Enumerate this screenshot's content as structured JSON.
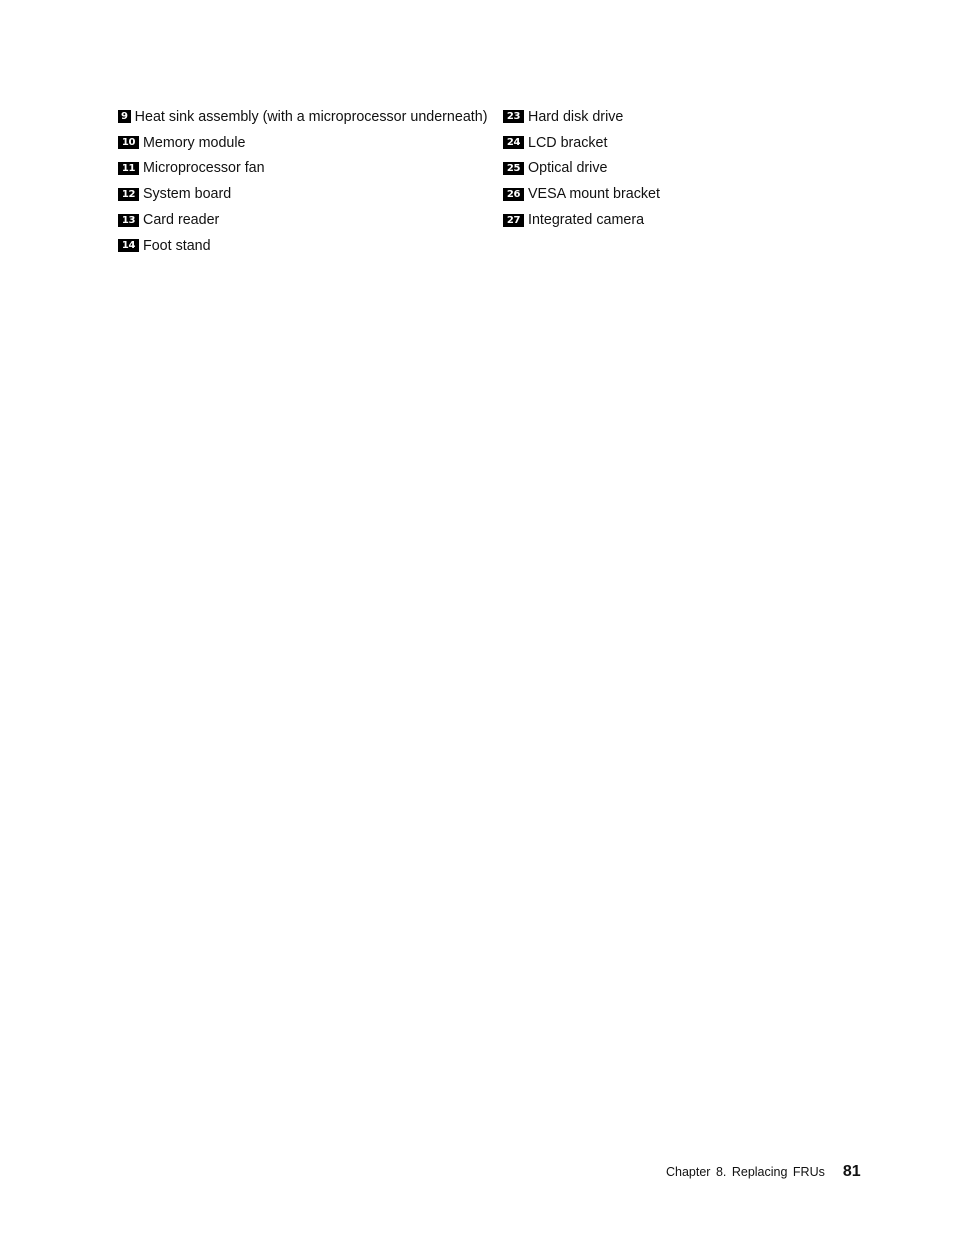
{
  "legend": {
    "left": [
      {
        "number": "9",
        "label": "Heat sink assembly (with a microprocessor underneath)"
      },
      {
        "number": "10",
        "label": "Memory module"
      },
      {
        "number": "11",
        "label": "Microprocessor fan"
      },
      {
        "number": "12",
        "label": "System board"
      },
      {
        "number": "13",
        "label": "Card reader"
      },
      {
        "number": "14",
        "label": "Foot stand"
      }
    ],
    "right": [
      {
        "number": "23",
        "label": "Hard disk drive"
      },
      {
        "number": "24",
        "label": "LCD bracket"
      },
      {
        "number": "25",
        "label": "Optical drive"
      },
      {
        "number": "26",
        "label": "VESA mount bracket"
      },
      {
        "number": "27",
        "label": "Integrated camera"
      }
    ]
  },
  "footer": {
    "chapter": "Chapter 8. Replacing FRUs",
    "page_number": "81"
  }
}
